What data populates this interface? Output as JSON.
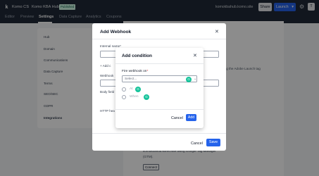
{
  "header": {
    "logo": "k",
    "org": "Komo CS",
    "separator": "/",
    "hub": "Komo KBA Hub",
    "status": "Published",
    "site_url": "komokbahub.komo.site",
    "share_label": "Share",
    "launch_label": "Launch",
    "launch_chevron": "▾",
    "gear_glyph": "⚙",
    "avatar_initial": "T"
  },
  "tabs": [
    {
      "label": "Editor"
    },
    {
      "label": "Preview"
    },
    {
      "label": "Settings",
      "active": true
    },
    {
      "label": "Data Capture"
    },
    {
      "label": "Analytics"
    },
    {
      "label": "Coupons"
    }
  ],
  "sidebar": {
    "items": [
      {
        "label": "Hub"
      },
      {
        "label": "Domain"
      },
      {
        "label": "Communications"
      },
      {
        "label": "Data Capture"
      },
      {
        "label": "Terms"
      },
      {
        "label": "SEO/SEC"
      },
      {
        "label": "GDPR"
      },
      {
        "label": "Integrations",
        "active": true
      }
    ]
  },
  "content": {
    "adobe_text": "h using the Adobe Launch tag",
    "gtm_text_1": "komokbahub.komo.site using Google Tag Manager",
    "gtm_text_2": "(GTM).",
    "connect_label": "Connect"
  },
  "webhook_modal": {
    "title": "Add Webhook",
    "close_glyph": "✕",
    "internal_name_label": "Internal name",
    "add_condition_label": "+ Add c",
    "webhook_label": "Webhook",
    "body_fields_label": "Body field",
    "http_headers_label": "HTTP hea",
    "cancel_label": "Cancel",
    "save_label": "Save",
    "required_mark": "*"
  },
  "condition_modal": {
    "title": "Add condition",
    "close_glyph": "✕",
    "field_label": "Fire webhook on",
    "required_mark": "*",
    "select_placeholder": "Select...",
    "select_chevron": "⌄",
    "grammarly_glyph": "G",
    "options": [
      {
        "label": "At"
      },
      {
        "label": "When"
      }
    ],
    "cancel_label": "Cancel",
    "add_label": "Add"
  },
  "colors": {
    "primary": "#2563eb",
    "topbar": "#1f2937",
    "badge_bg": "#d1fae5",
    "grammarly": "#15c39a"
  }
}
